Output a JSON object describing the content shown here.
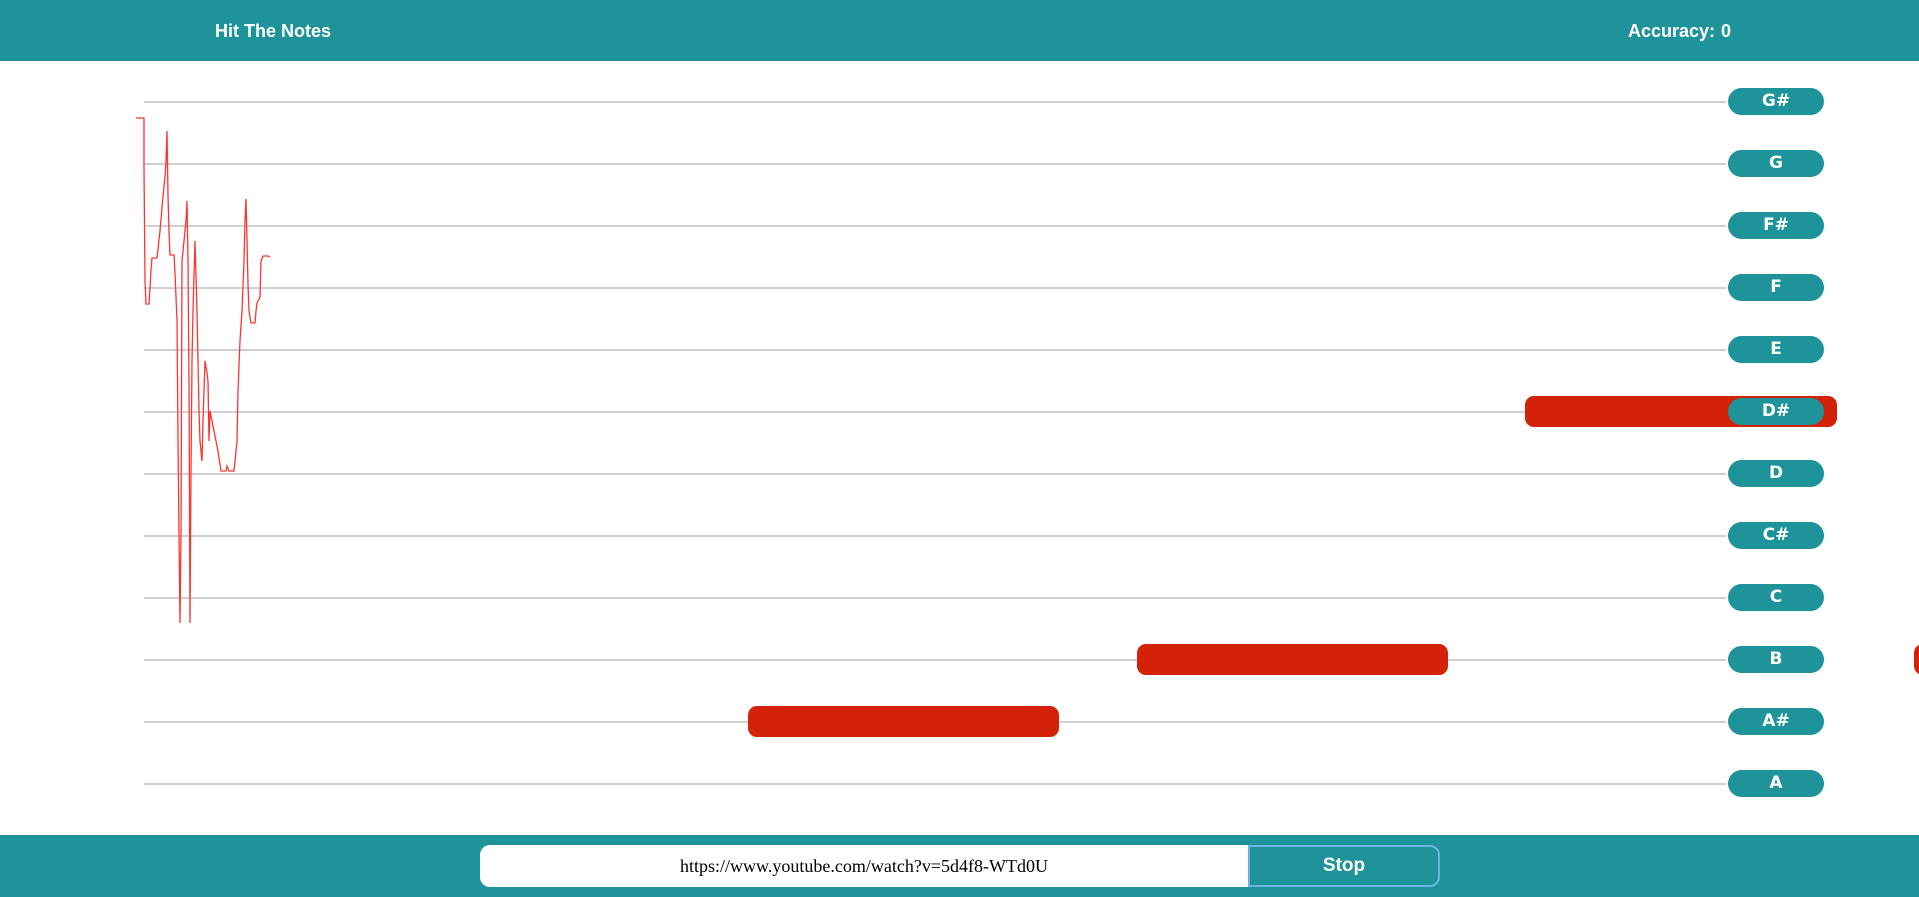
{
  "header": {
    "title": "Hit The Notes",
    "accuracy_label": "Accuracy:",
    "accuracy_value": "0"
  },
  "staff": {
    "notes": [
      "G#",
      "G",
      "F#",
      "F",
      "E",
      "D#",
      "D",
      "C#",
      "C",
      "B",
      "A#",
      "A"
    ]
  },
  "target_notes": [
    {
      "note": "A#"
    },
    {
      "note": "B"
    },
    {
      "note": "D#"
    },
    {
      "note": "B"
    }
  ],
  "controls": {
    "url_value": "https://www.youtube.com/watch?v=5d4f8-WTd0U",
    "stop_label": "Stop"
  },
  "colors": {
    "accent": "#1e9399",
    "note_bar": "#d42208",
    "pitch_line": "#ff3333",
    "staff_line": "#d0d0d0"
  }
}
